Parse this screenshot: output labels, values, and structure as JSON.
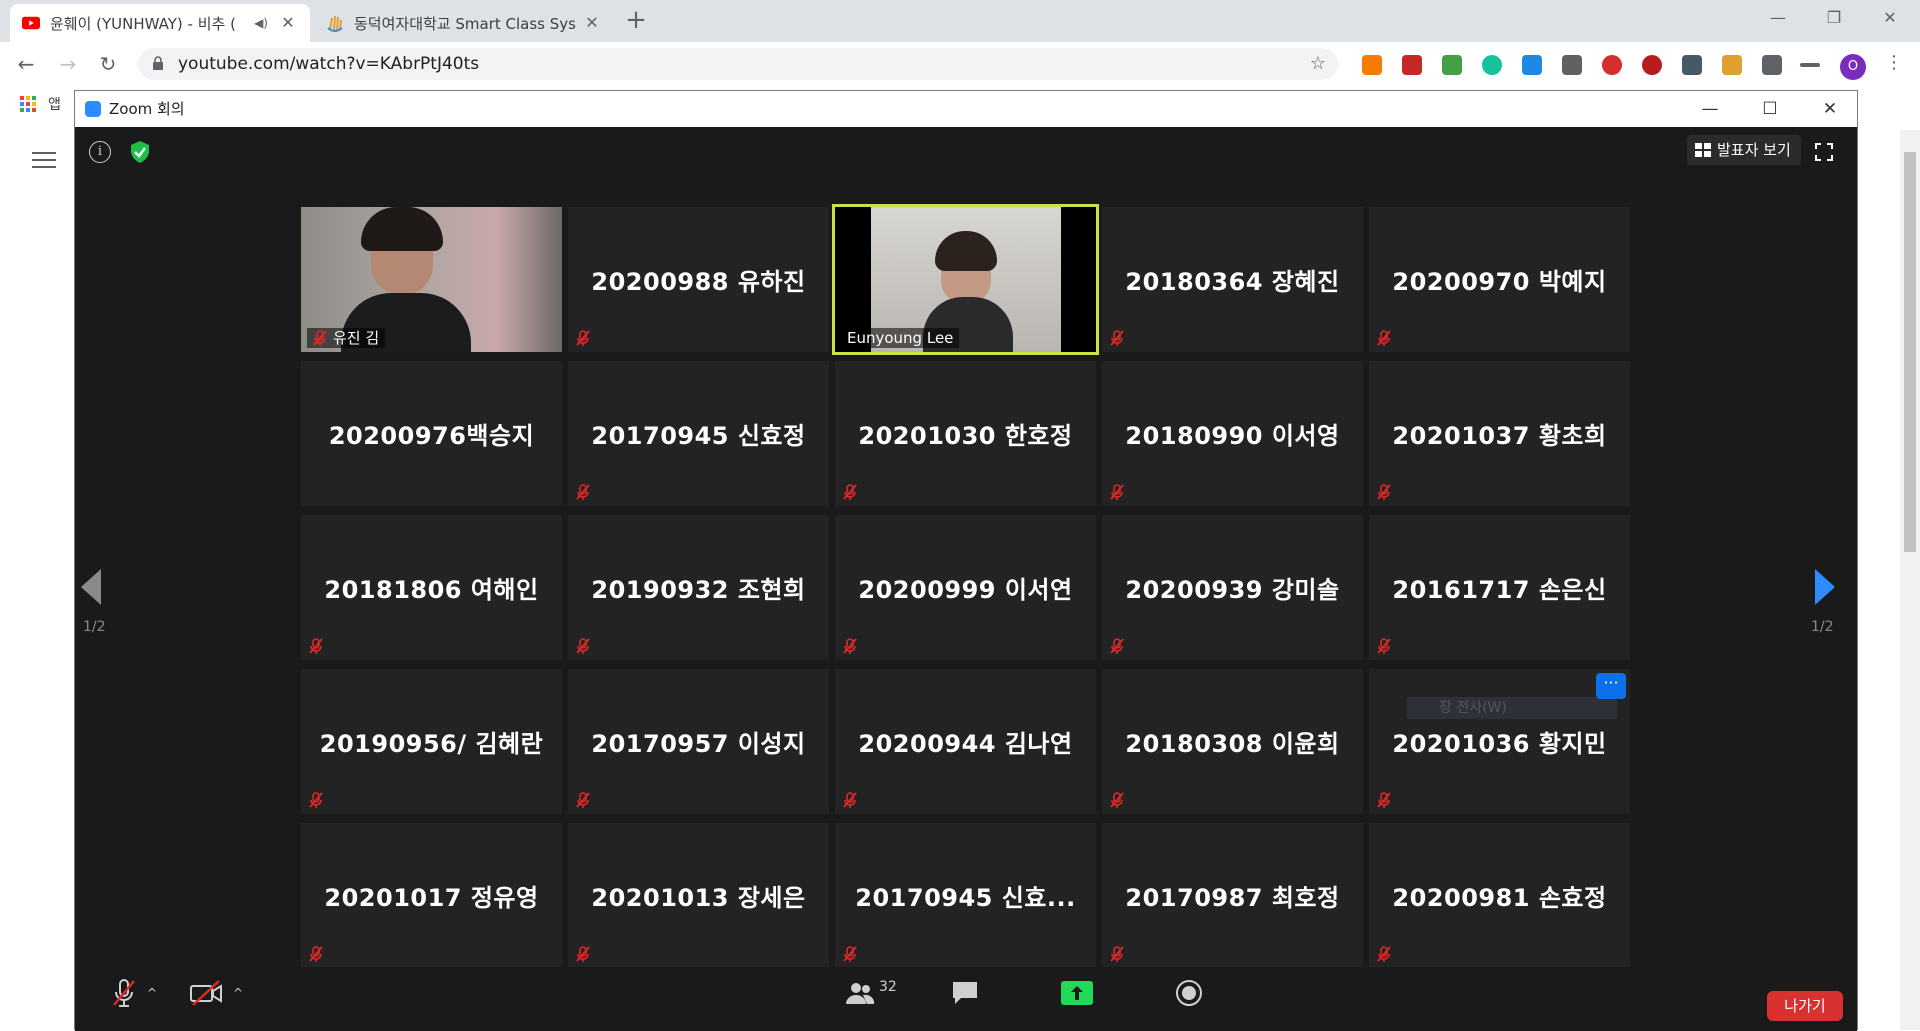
{
  "browser": {
    "tabs": [
      {
        "title": "윤훼이 (YUNHWAY) - 비추 (",
        "active": true,
        "favicon": "youtube-icon",
        "audio": true
      },
      {
        "title": "동덕여자대학교 Smart Class Sys",
        "active": false,
        "favicon": "hand-logo-icon"
      }
    ],
    "url": "youtube.com/watch?v=KAbrPtJ40ts",
    "profile_initial": "O",
    "bookmarks_apps_label": "앱"
  },
  "zoom": {
    "window_title": "Zoom 회의",
    "speaker_view_label": "발표자 보기",
    "page_indicator_left": "1/2",
    "page_indicator_right": "1/2",
    "participants_count": "32",
    "leave_label": "나가기",
    "ghost_label": "장 전사(W)",
    "more_label": "···",
    "tiles": [
      {
        "name": "유진 김",
        "video": true
      },
      {
        "name": "20200988 유하진"
      },
      {
        "name": "Eunyoung Lee",
        "video": true,
        "active": true
      },
      {
        "name": "20180364 장혜진"
      },
      {
        "name": "20200970 박예지"
      },
      {
        "name": "20200976백승지",
        "muted": false
      },
      {
        "name": "20170945 신효정"
      },
      {
        "name": "20201030 한호정"
      },
      {
        "name": "20180990 이서영"
      },
      {
        "name": "20201037 황초희"
      },
      {
        "name": "20181806 여해인"
      },
      {
        "name": "20190932 조현희"
      },
      {
        "name": "20200999 이서연"
      },
      {
        "name": "20200939 강미솔"
      },
      {
        "name": "20161717 손은신"
      },
      {
        "name": "20190956/ 김혜란"
      },
      {
        "name": "20170957 이성지"
      },
      {
        "name": "20200944 김나연"
      },
      {
        "name": "20180308 이윤희"
      },
      {
        "name": "20201036 황지민"
      },
      {
        "name": "20201017 정유영"
      },
      {
        "name": "20201013 장세은"
      },
      {
        "name": "20170945 신효..."
      },
      {
        "name": "20170987 최호정"
      },
      {
        "name": "20200981 손효정"
      }
    ]
  },
  "colors": {
    "active_speaker_border": "#c8e34a",
    "leave_button": "#d93030",
    "share_button": "#23d959",
    "nav_arrow_active": "#2d8cff",
    "mute_icon": "#e02828"
  }
}
